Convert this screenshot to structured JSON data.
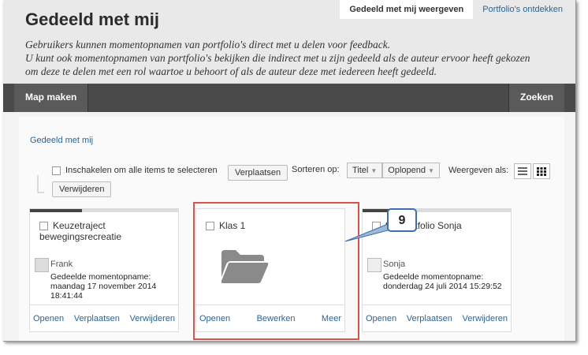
{
  "header": {
    "title": "Gedeeld met mij",
    "tabs": [
      "Gedeeld met mij weergeven",
      "Portfolio's ontdekken"
    ],
    "intro_line1": "Gebruikers kunnen momentopnamen van portfolio's direct met u delen voor feedback.",
    "intro_line2": "U kunt ook momentopnamen van portfolio's bekijken die indirect met u zijn gedeeld als de auteur ervoor heeft gekozen om deze te delen met een rol waartoe u behoort of als de auteur deze met iedereen heeft gedeeld."
  },
  "toolbar": {
    "left_label": "Map maken",
    "right_label": "Zoeken"
  },
  "main": {
    "breadcrumb": "Gedeeld met mij",
    "select_all_label": "Inschakelen om alle items te selecteren",
    "move_button": "Verplaatsen",
    "delete_button": "Verwijderen",
    "sort_label": "Sorteren op:",
    "sort_field": "Titel",
    "sort_order": "Oplopend",
    "view_label": "Weergeven als:"
  },
  "cards": [
    {
      "name": "Keuzetraject bewegingsrecreatie",
      "owner": "Frank",
      "meta": "Gedeelde momentopname: maandag 17 november 2014 18:41:44",
      "actions": [
        "Openen",
        "Verplaatsen",
        "Verwijderen"
      ]
    },
    {
      "name": "Klas 1",
      "owner": "",
      "meta": "",
      "icon": "folder-icon",
      "actions": [
        "Openen",
        "Bewerken",
        "Meer"
      ]
    },
    {
      "name": "fen portfolio Sonja",
      "owner": "Sonja",
      "meta": "Gedeelde momentopname: donderdag 24 juli 2014 15:29:52",
      "actions": [
        "Openen",
        "Verplaatsen",
        "Verwijderen"
      ]
    }
  ],
  "annotation": {
    "number": "9",
    "highlight_color": "#d9534f",
    "callout_color": "#3d6fa8"
  }
}
